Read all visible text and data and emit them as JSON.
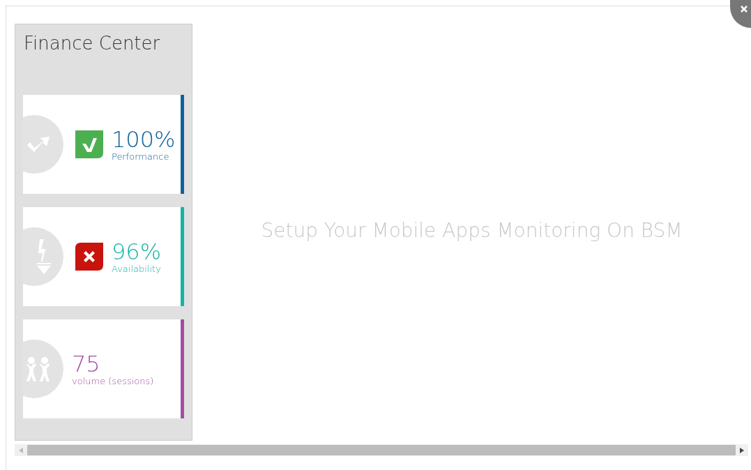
{
  "panel": {
    "title": "Finance Center",
    "tiles": [
      {
        "kind": "trend",
        "value": "100%",
        "label": "Performance",
        "color": "#0e6399",
        "badge": {
          "passed": true
        }
      },
      {
        "kind": "power",
        "value": "96%",
        "label": "Availability",
        "color": "#16b3a6",
        "badge": {
          "passed": false
        }
      },
      {
        "kind": "people",
        "value": "75",
        "label": "volume (sessions)",
        "color": "#a24ea3"
      }
    ]
  },
  "message": "Setup Your Mobile Apps Monitoring On BSM"
}
